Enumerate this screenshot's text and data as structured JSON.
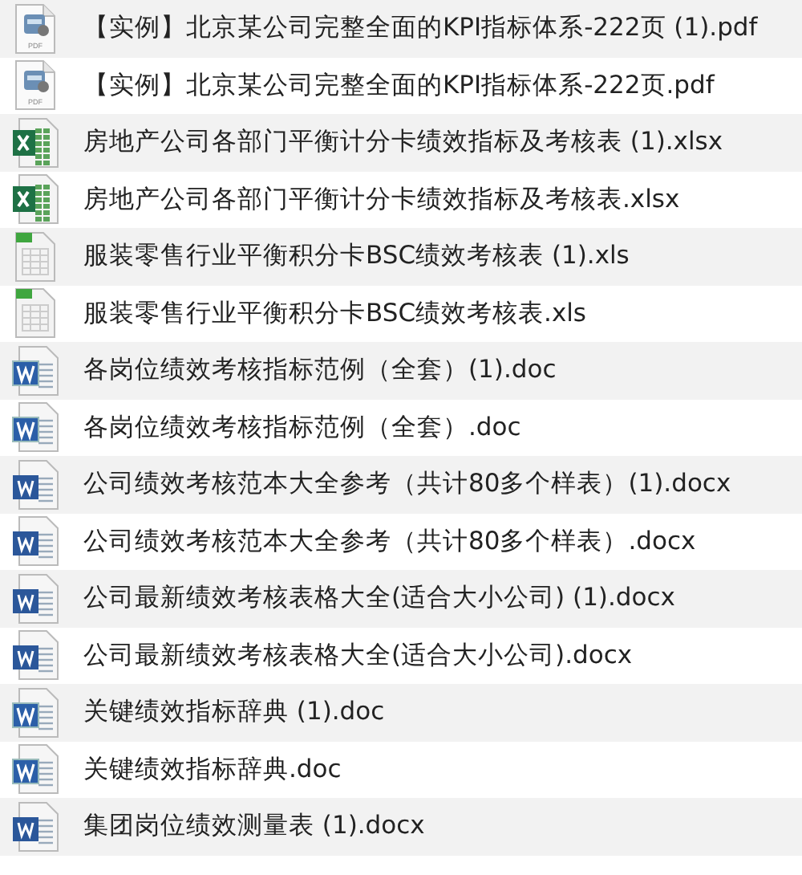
{
  "files": [
    {
      "name": "【实例】北京某公司完整全面的KPI指标体系-222页 (1).pdf",
      "kind": "pdf",
      "icon_label": "PDF"
    },
    {
      "name": "【实例】北京某公司完整全面的KPI指标体系-222页.pdf",
      "kind": "pdf",
      "icon_label": "PDF"
    },
    {
      "name": "房地产公司各部门平衡计分卡绩效指标及考核表 (1).xlsx",
      "kind": "xlsx"
    },
    {
      "name": "房地产公司各部门平衡计分卡绩效指标及考核表.xlsx",
      "kind": "xlsx"
    },
    {
      "name": "服装零售行业平衡积分卡BSC绩效考核表 (1).xls",
      "kind": "xls"
    },
    {
      "name": "服装零售行业平衡积分卡BSC绩效考核表.xls",
      "kind": "xls"
    },
    {
      "name": "各岗位绩效考核指标范例（全套）(1).doc",
      "kind": "doc"
    },
    {
      "name": "各岗位绩效考核指标范例（全套）.doc",
      "kind": "doc"
    },
    {
      "name": "公司绩效考核范本大全参考（共计80多个样表）(1).docx",
      "kind": "docx"
    },
    {
      "name": "公司绩效考核范本大全参考（共计80多个样表）.docx",
      "kind": "docx"
    },
    {
      "name": "公司最新绩效考核表格大全(适合大小公司) (1).docx",
      "kind": "docx"
    },
    {
      "name": "公司最新绩效考核表格大全(适合大小公司).docx",
      "kind": "docx"
    },
    {
      "name": "关键绩效指标辞典 (1).doc",
      "kind": "doc"
    },
    {
      "name": "关键绩效指标辞典.doc",
      "kind": "doc"
    },
    {
      "name": "集团岗位绩效测量表 (1).docx",
      "kind": "docx"
    }
  ]
}
